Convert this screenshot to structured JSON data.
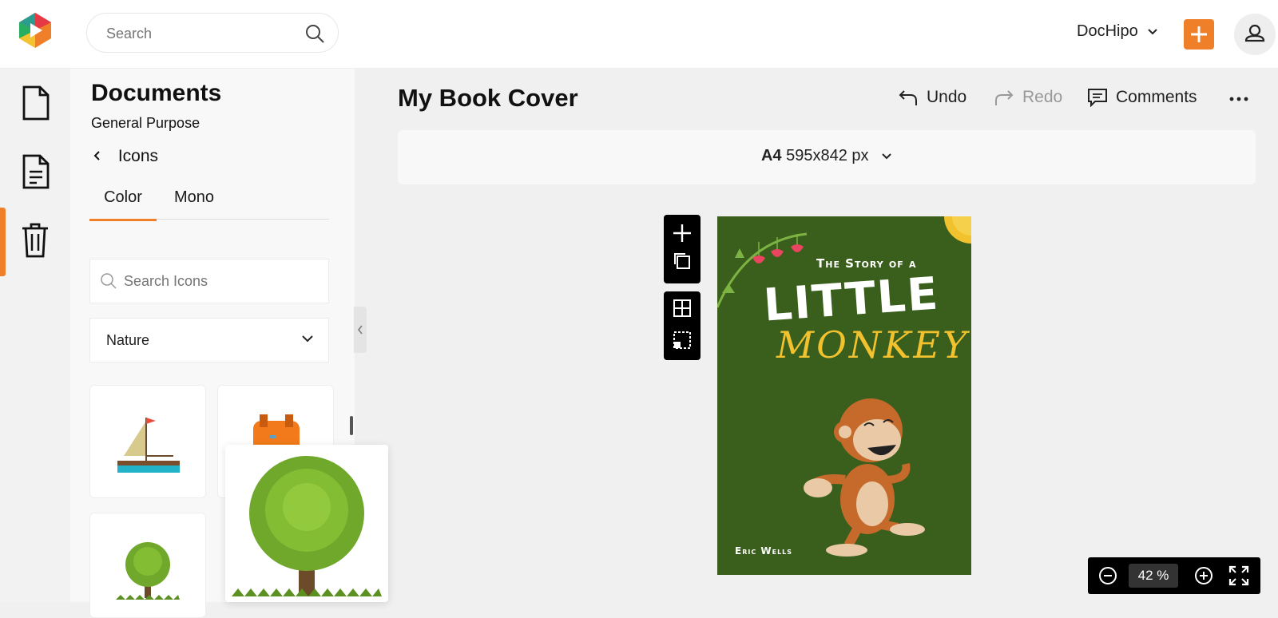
{
  "header": {
    "search_placeholder": "Search",
    "account_label": "DocHipo",
    "logo_icon": "dochipo-play-logo",
    "plus_icon": "plus-icon",
    "user_icon": "user-icon"
  },
  "left_rail": {
    "items": [
      {
        "icon": "document-icon"
      },
      {
        "icon": "file-text-icon",
        "active": true
      },
      {
        "icon": "trash-icon"
      }
    ]
  },
  "panel": {
    "title": "Documents",
    "subtitle": "General Purpose",
    "back_label": "Icons",
    "tabs": [
      {
        "label": "Color",
        "active": true
      },
      {
        "label": "Mono",
        "active": false
      }
    ],
    "search_placeholder": "Search Icons",
    "category": "Nature",
    "icons": [
      "sailboat-icon",
      "backpack-icon",
      "tree-icon",
      "tree-large-icon"
    ]
  },
  "editor": {
    "title": "My Book Cover",
    "undo_label": "Undo",
    "redo_label": "Redo",
    "comments_label": "Comments",
    "size_name": "A4",
    "size_dims": "595x842 px",
    "zoom_value": "42",
    "zoom_unit": "%"
  },
  "cover": {
    "line1": "The Story of a",
    "line2": "LITTLE",
    "line3": "MONKEY",
    "author": "Eric Wells",
    "background": "#3a5f1c",
    "accent_yellow": "#f2c12e"
  },
  "colors": {
    "accent": "#f07f2a"
  }
}
